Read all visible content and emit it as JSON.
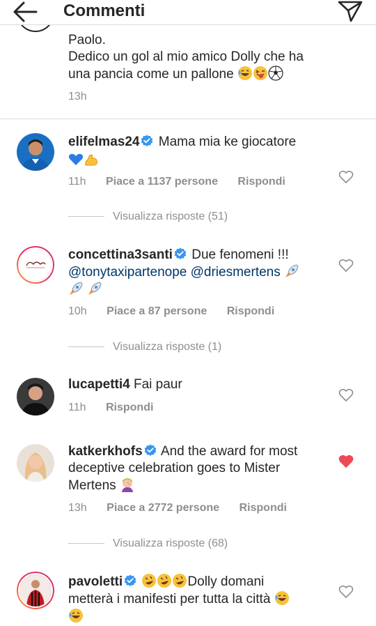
{
  "header": {
    "title": "Commenti"
  },
  "caption": {
    "line1": "Paolo.",
    "line2": "Dedico un gol al mio amico Dolly che ha",
    "line3": "una pancia come un pallone",
    "time": "13h"
  },
  "comments": [
    {
      "username": "elifelmas24",
      "text": "Mama mia ke giocatore",
      "time": "11h",
      "likes": "Piace a 1137 persone",
      "reply": "Rispondi",
      "view_replies": "Visualizza risposte (51)",
      "liked": false
    },
    {
      "username": "concettina3santi",
      "text": "Due fenomeni !!!",
      "mention1": "@tonytaxipartenope",
      "mention2": "@driesmertens",
      "time": "10h",
      "likes": "Piace a 87 persone",
      "reply": "Rispondi",
      "view_replies": "Visualizza risposte (1)",
      "liked": false
    },
    {
      "username": "lucapetti4",
      "text": "Fai paur",
      "time": "11h",
      "reply": "Rispondi",
      "liked": false
    },
    {
      "username": "katkerkhofs",
      "text_line1": "And the award for most",
      "text_line2": "deceptive celebration goes to Mister",
      "text_line3": "Mertens",
      "time": "13h",
      "likes": "Piace a 2772 persone",
      "reply": "Rispondi",
      "view_replies": "Visualizza risposte (68)",
      "liked": true
    },
    {
      "username": "pavoletti",
      "text_line1": "Dolly domani",
      "text_line2": "metterà i manifesti per tutta la città",
      "liked": false
    }
  ],
  "colors": {
    "text": "#262626",
    "muted": "#8e8e8e",
    "verified": "#3897f0",
    "liked_heart": "#ed4956"
  }
}
